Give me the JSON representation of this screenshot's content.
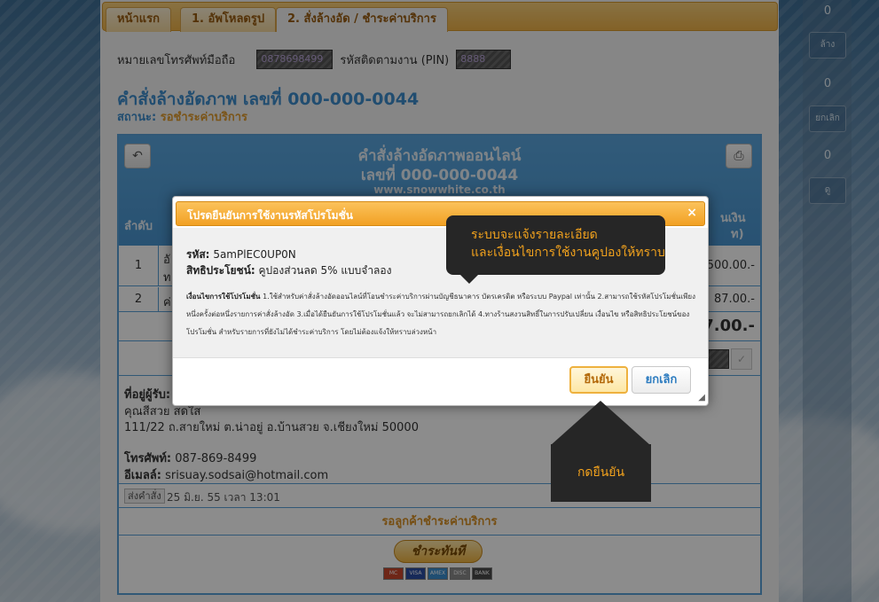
{
  "sidebar": {
    "counts": [
      "0",
      "0",
      "0"
    ],
    "buttons": [
      "ล้าง",
      "ยกเลิก",
      "ดู"
    ]
  },
  "tabs": [
    "หน้าแรก",
    "1. อัพโหลดรูป",
    "2. สั่งล้างอัด / ชำระค่าบริการ"
  ],
  "phone": {
    "label": "หมายเลขโทรศัพท์มือถือ",
    "value": "0878698499",
    "pin_label": "รหัสติดตามงาน (PIN)",
    "pin_value": "8888"
  },
  "order": {
    "title": "คำสั่งล้างอัดภาพ เลขที่ 000-000-0044",
    "status_label": "สถานะ:",
    "status_value": "รอชำระค่าบริการ"
  },
  "receipt": {
    "title": "คำสั่งล้างอัดภาพออนไลน์",
    "number": "เลขที่ 000-000-0044",
    "site": "www.snowwhite.co.th",
    "col_no": "ลำดับ",
    "col_amount_partial": "นเงิน",
    "col_amount_partial2": "ท)",
    "rows": [
      {
        "no": "1",
        "text_a": "อั",
        "text_b": "ท",
        "amount": "500.00.-"
      },
      {
        "no": "2",
        "text_a": "ค่",
        "text_b": "",
        "amount": "87.00.-"
      }
    ],
    "total_partial": "7.00.-",
    "address_label": "ที่อยู่ผู้รับ:",
    "address_name": "คุณสีสวย สดใส",
    "address_line": "111/22 ถ.สายใหม่ ต.น่าอยู่ อ.บ้านสวย จ.เชียงใหม่ 50000",
    "phone_label": "โทรศัพท์:",
    "phone_value": "087-869-8499",
    "email_label": "อีเมลล์:",
    "email_value": "srisuay.sodsai@hotmail.com",
    "send_label": "ส่งคำสั่ง",
    "send_date": "25 มิ.ย. 55 เวลา 13:01",
    "waiting": "รอลูกค้าชำระค่าบริการ",
    "pay_button": "ชำระทันที",
    "cards": [
      "MC",
      "VISA",
      "AMEX",
      "DISC",
      "BANK"
    ],
    "card_colors": [
      "#c8452b",
      "#2a4da3",
      "#3b8ed0",
      "#8a8a8a",
      "#4a4a4a"
    ]
  },
  "modal": {
    "title": "โปรดยืนยันการใช้งานรหัสโปรโมชั่น",
    "close": "×",
    "code_label": "รหัส:",
    "code_value": "5amPlEC0UP0N",
    "benefit_label": "สิทธิประโยชน์:",
    "benefit_value": "คูปองส่วนลด 5% แบบจำลอง",
    "cond_label": "เงื่อนไขการใช้โปรโมชั่น",
    "cond_text": "1.ใช้สำหรับค่าสั่งล้างอัดออนไลน์ที่โอนชำระค่าบริการผ่านบัญชีธนาคาร บัตรเครดิต หรือระบบ Paypal เท่านั้น 2.สามารถใช้รหัสโปรโมชั่นเพียงหนึ่งครั้งต่อหนึ่งรายการค่าสั่งล้างอัด 3.เมื่อได้ยืนยันการใช้โปรโมชั่นแล้ว จะไม่สามารถยกเลิกได้ 4.ทางร้านสงวนสิทธิ์ในการปรับเปลี่ยน เงื่อนไข หรือสิทธิประโยชน์ของโปรโมชั่น สำหรับรายการที่ยังไม่ได้ชำระค่าบริการ โดยไม่ต้องแจ้งให้ทราบล่วงหน้า",
    "confirm": "ยืนยัน",
    "cancel": "ยกเลิก"
  },
  "tooltips": {
    "info_line1": "ระบบจะแจ้งรายละเอียด",
    "info_line2": "และเงื่อนไขการใช้งานคูปองให้ทราบ",
    "confirm_hint": "กดยืนยัน"
  }
}
